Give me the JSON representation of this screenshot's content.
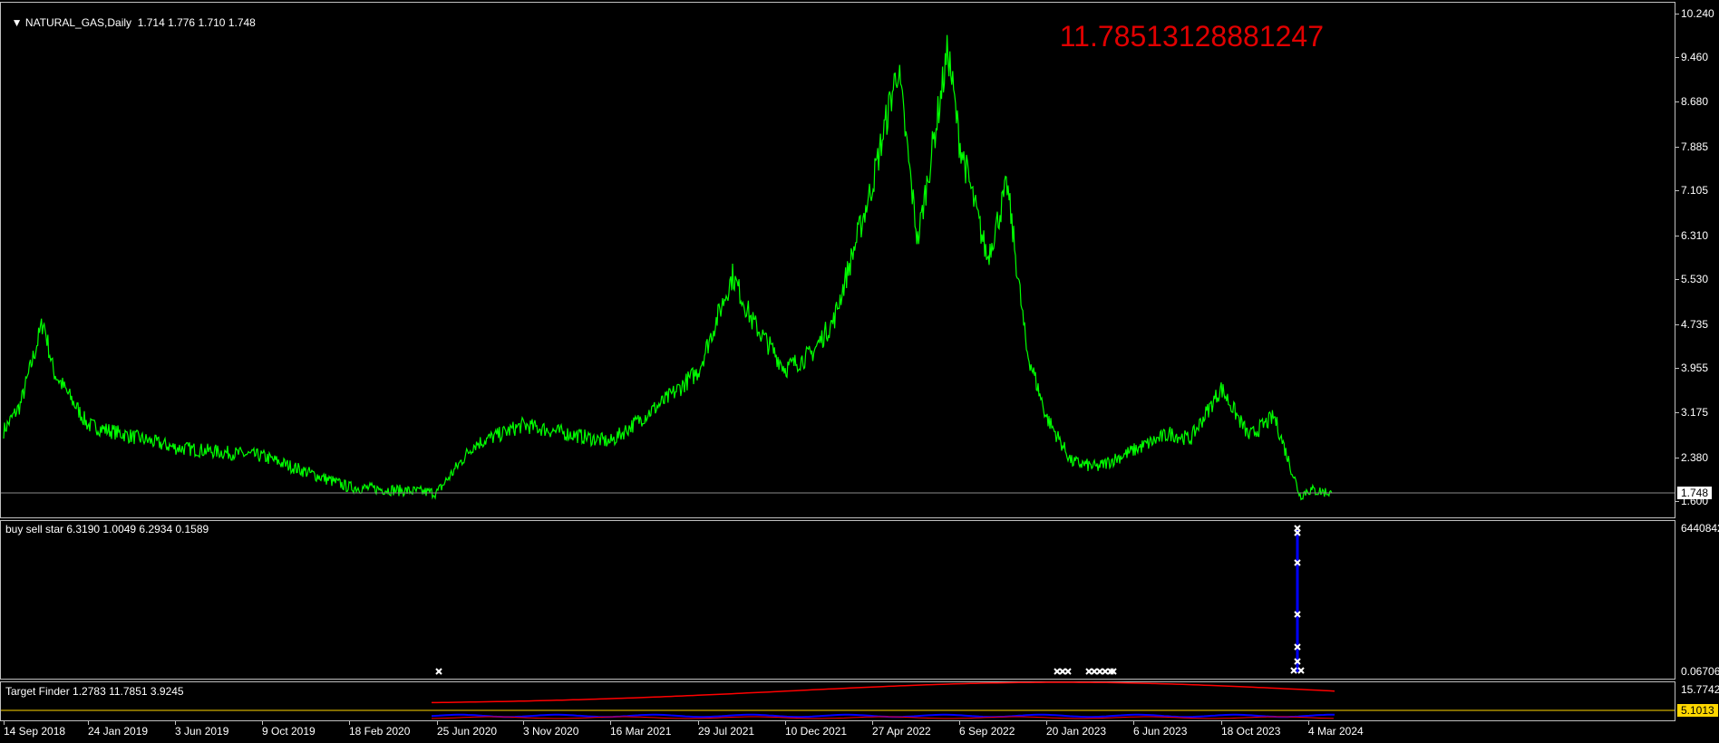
{
  "main": {
    "header": "NATURAL_GAS,Daily  1.714 1.776 1.710 1.748",
    "big_value": "11.78513128881247",
    "price_axis": [
      "10.240",
      "9.460",
      "8.680",
      "7.885",
      "7.105",
      "6.310",
      "5.530",
      "4.735",
      "3.955",
      "3.175",
      "2.380",
      "1.600"
    ],
    "current_price": "1.748",
    "colors": {
      "price_line": "#00ff00",
      "big_value": "#e00000",
      "bg": "#000000"
    }
  },
  "indicator1": {
    "label": "buy sell star 6.3190 1.0049 6.2934 0.1589",
    "axis_top": "6440842",
    "axis_bottom": "0.06706",
    "colors": {
      "line": "#0000ff",
      "marker": "#ffffff"
    }
  },
  "indicator2": {
    "label": "Target Finder 1.2783 11.7851 3.9245",
    "axis_top": "15.7742",
    "current_value": "5.1013",
    "colors": {
      "red": "#ff0000",
      "blue": "#0000ff",
      "level": "#ffd700"
    }
  },
  "time_axis": [
    "14 Sep 2018",
    "24 Jan 2019",
    "3 Jun 2019",
    "9 Oct 2019",
    "18 Feb 2020",
    "25 Jun 2020",
    "3 Nov 2020",
    "16 Mar 2021",
    "29 Jul 2021",
    "10 Dec 2021",
    "27 Apr 2022",
    "6 Sep 2022",
    "20 Jan 2023",
    "6 Jun 2023",
    "18 Oct 2023",
    "4 Mar 2024"
  ],
  "chart_data": {
    "type": "line",
    "title": "NATURAL_GAS,Daily",
    "ylim": [
      1.33,
      10.43
    ],
    "series": [
      {
        "name": "NATURAL_GAS",
        "x": [
          "2018-09-14",
          "2018-10-10",
          "2018-11-15",
          "2018-12-01",
          "2019-01-24",
          "2019-06-03",
          "2019-10-09",
          "2020-02-18",
          "2020-06-25",
          "2020-08-20",
          "2020-11-03",
          "2021-03-16",
          "2021-06-10",
          "2021-07-29",
          "2021-09-20",
          "2021-10-20",
          "2021-12-10",
          "2022-01-20",
          "2022-02-25",
          "2022-04-27",
          "2022-06-05",
          "2022-07-05",
          "2022-08-20",
          "2022-09-06",
          "2022-10-20",
          "2022-11-20",
          "2022-12-20",
          "2023-01-20",
          "2023-03-01",
          "2023-04-10",
          "2023-06-06",
          "2023-08-01",
          "2023-09-01",
          "2023-10-18",
          "2023-12-01",
          "2024-01-10",
          "2024-02-20",
          "2024-03-04",
          "2024-04-10"
        ],
        "y": [
          2.85,
          3.3,
          4.8,
          3.9,
          2.95,
          2.55,
          2.4,
          1.85,
          1.75,
          2.6,
          2.95,
          2.65,
          3.4,
          3.9,
          5.6,
          4.8,
          3.95,
          4.2,
          4.8,
          7.2,
          9.3,
          6.2,
          9.6,
          8.0,
          5.9,
          7.2,
          4.3,
          3.1,
          2.3,
          2.2,
          2.5,
          2.8,
          2.7,
          3.6,
          2.75,
          3.1,
          1.7,
          1.8,
          1.75
        ]
      }
    ]
  }
}
